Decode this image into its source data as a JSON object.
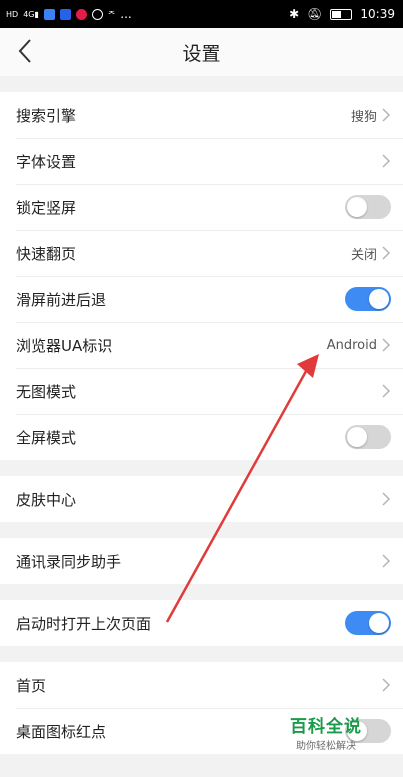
{
  "status_bar": {
    "left_text": "...",
    "time": "10:39",
    "icons": [
      "hd-icon",
      "signal-icon",
      "app-icon-blue",
      "app-icon-blue-2",
      "app-icon-red",
      "app-icon-circle",
      "app-icon-person"
    ],
    "right_icons": [
      "bluetooth-icon",
      "mute-icon",
      "battery-icon"
    ]
  },
  "header": {
    "title": "设置"
  },
  "groups": [
    {
      "rows": [
        {
          "label": "搜索引擎",
          "value": "搜狗",
          "control": "chevron"
        },
        {
          "label": "字体设置",
          "value": "",
          "control": "chevron"
        },
        {
          "label": "锁定竖屏",
          "control": "toggle",
          "on": false
        },
        {
          "label": "快速翻页",
          "value": "关闭",
          "control": "chevron"
        },
        {
          "label": "滑屏前进后退",
          "control": "toggle",
          "on": true
        },
        {
          "label": "浏览器UA标识",
          "value": "Android",
          "control": "chevron"
        },
        {
          "label": "无图模式",
          "value": "",
          "control": "chevron"
        },
        {
          "label": "全屏模式",
          "control": "toggle",
          "on": false
        }
      ]
    },
    {
      "rows": [
        {
          "label": "皮肤中心",
          "value": "",
          "control": "chevron"
        }
      ]
    },
    {
      "rows": [
        {
          "label": "通讯录同步助手",
          "value": "",
          "control": "chevron"
        }
      ]
    },
    {
      "rows": [
        {
          "label": "启动时打开上次页面",
          "control": "toggle",
          "on": true
        }
      ]
    },
    {
      "rows": [
        {
          "label": "首页",
          "value": "",
          "control": "chevron"
        },
        {
          "label": "桌面图标红点",
          "control": "toggle",
          "on": false
        }
      ]
    }
  ],
  "watermark": {
    "title": "百科全说",
    "subtitle": "助你轻松解决"
  },
  "colors": {
    "toggle_on": "#3e8cf3",
    "toggle_off": "#d6d6d6",
    "annotation_arrow": "#e03a3a",
    "watermark": "#1a9b4a"
  }
}
